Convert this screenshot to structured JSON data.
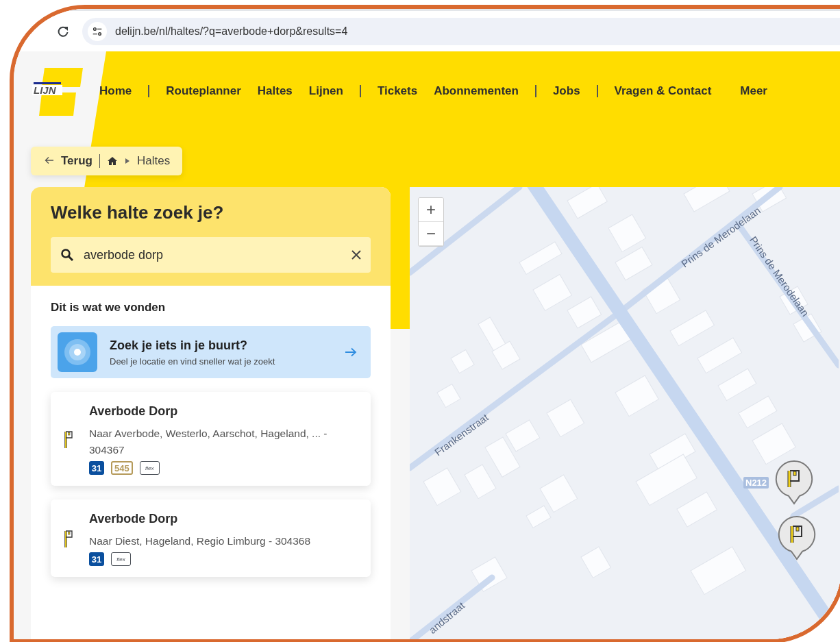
{
  "browser": {
    "url": "delijn.be/nl/haltes/?q=averbode+dorp&results=4"
  },
  "logo": {
    "text": "LIJN"
  },
  "nav": {
    "groups": [
      {
        "items": [
          "Home"
        ]
      },
      {
        "items": [
          "Routeplanner",
          "Haltes",
          "Lijnen"
        ]
      },
      {
        "items": [
          "Tickets",
          "Abonnementen"
        ]
      },
      {
        "items": [
          "Jobs"
        ]
      },
      {
        "items": [
          "Vragen & Contact"
        ]
      }
    ],
    "more": "Meer"
  },
  "breadcrumb": {
    "back": "Terug",
    "current": "Haltes"
  },
  "search_panel": {
    "title": "Welke halte zoek je?",
    "search": {
      "value": "averbode dorp"
    },
    "results_heading": "Dit is wat we vonden",
    "nearby": {
      "title": "Zoek je iets in je buurt?",
      "subtitle": "Deel je locatie en vind sneller wat je zoekt"
    },
    "results": [
      {
        "name": "Averbode Dorp",
        "description": "Naar Averbode, Westerlo, Aarschot, Hageland, ... - 304367",
        "lines": [
          {
            "label": "31",
            "kind": "filled",
            "color": "#0a4f9e"
          },
          {
            "label": "545",
            "kind": "outline",
            "color": "#b59a5a"
          },
          {
            "label": "flex",
            "kind": "flex",
            "color": "#4a4f57"
          }
        ]
      },
      {
        "name": "Averbode Dorp",
        "description": "Naar Diest, Hageland, Regio Limburg - 304368",
        "lines": [
          {
            "label": "31",
            "kind": "filled",
            "color": "#0a4f9e"
          },
          {
            "label": "flex",
            "kind": "flex",
            "color": "#4a4f57"
          }
        ]
      }
    ]
  },
  "map": {
    "zoom_in": "+",
    "zoom_out": "−",
    "streets": [
      "Frankenstraat",
      "Prins de Merodelaan",
      "Prins de Merodelaan",
      "andstraat"
    ],
    "road_number": "N212"
  }
}
